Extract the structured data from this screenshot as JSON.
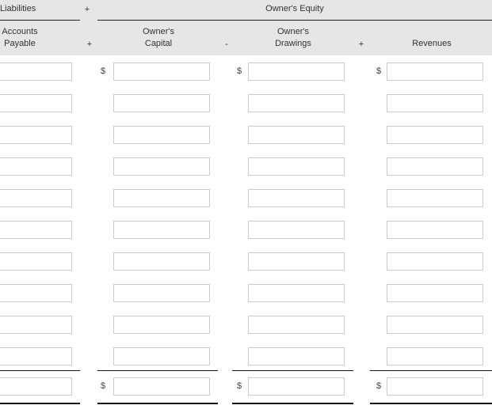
{
  "header": {
    "liabilities": "Liabilities",
    "owners_equity": "Owner's Equity",
    "op_top": "+"
  },
  "columns": [
    {
      "label_line1": "Accounts",
      "label_line2": "Payable"
    },
    {
      "label_line1": "Owner's",
      "label_line2": "Capital"
    },
    {
      "label_line1": "Owner's",
      "label_line2": "Drawings"
    },
    {
      "label_line1": "",
      "label_line2": "Revenues"
    }
  ],
  "operators": [
    "+",
    "-",
    "+"
  ],
  "currency_symbol": "$",
  "row_count": 10
}
